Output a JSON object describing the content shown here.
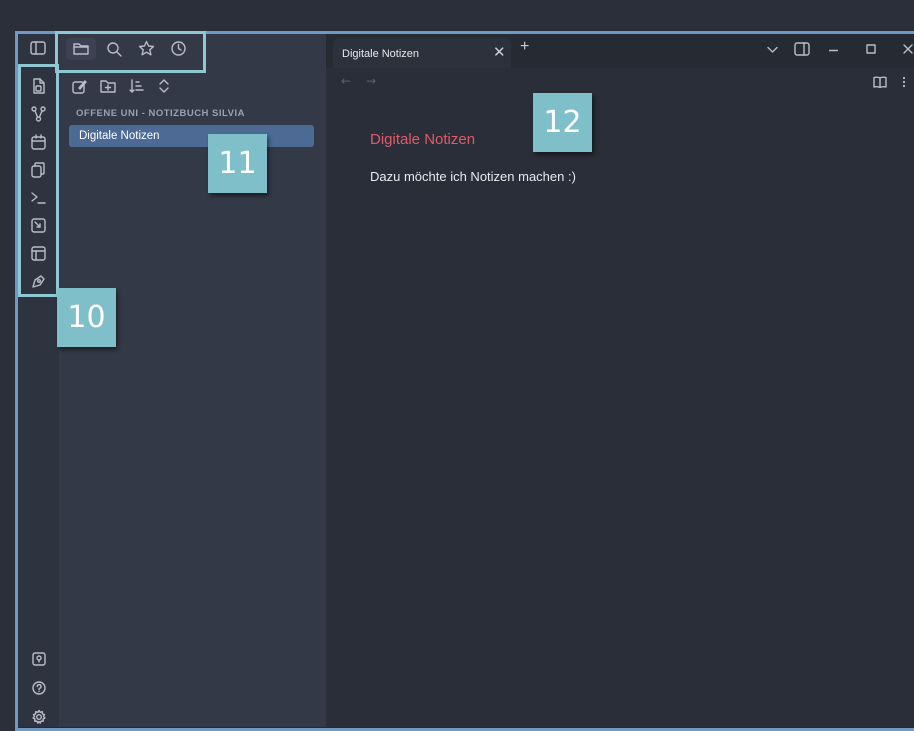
{
  "tab": {
    "title": "Digitale Notizen",
    "close_label": "✕",
    "new_tab_label": "+"
  },
  "explorer": {
    "vault_name": "OFFENE UNI - NOTIZBUCH SILVIA",
    "files": [
      {
        "name": "Digitale Notizen",
        "active": true
      }
    ]
  },
  "note": {
    "title": "Digitale Notizen",
    "body": "Dazu möchte ich Notizen machen :)"
  },
  "callouts": {
    "c10": "10",
    "c11": "11",
    "c12": "12"
  },
  "icons": {
    "left_sidebar_toggle": "sidebar-toggle-icon",
    "top_tabs": [
      "folder-icon",
      "search-icon",
      "star-icon",
      "clock-icon"
    ],
    "explorer_actions": [
      "new-note-icon",
      "new-folder-icon",
      "sort-icon",
      "collapse-icon"
    ],
    "ribbon": [
      "open-quick-switcher-icon",
      "graph-view-icon",
      "daily-note-icon",
      "templates-icon",
      "command-palette-icon",
      "canvas-icon",
      "slides-icon",
      "draw-icon"
    ],
    "ribbon_bottom": [
      "vault-icon",
      "help-icon",
      "settings-icon"
    ],
    "window": [
      "chevron-down-icon",
      "right-sidebar-icon",
      "minimize-icon",
      "maximize-icon",
      "close-icon"
    ],
    "note_header": [
      "back-arrow-icon",
      "forward-arrow-icon",
      "reading-view-icon",
      "more-options-icon"
    ]
  },
  "colors": {
    "highlight_border": "#6f9ac6",
    "callout_bg": "#7fbfc9",
    "note_title": "#e05b67",
    "active_file_bg": "#4d6a94"
  }
}
